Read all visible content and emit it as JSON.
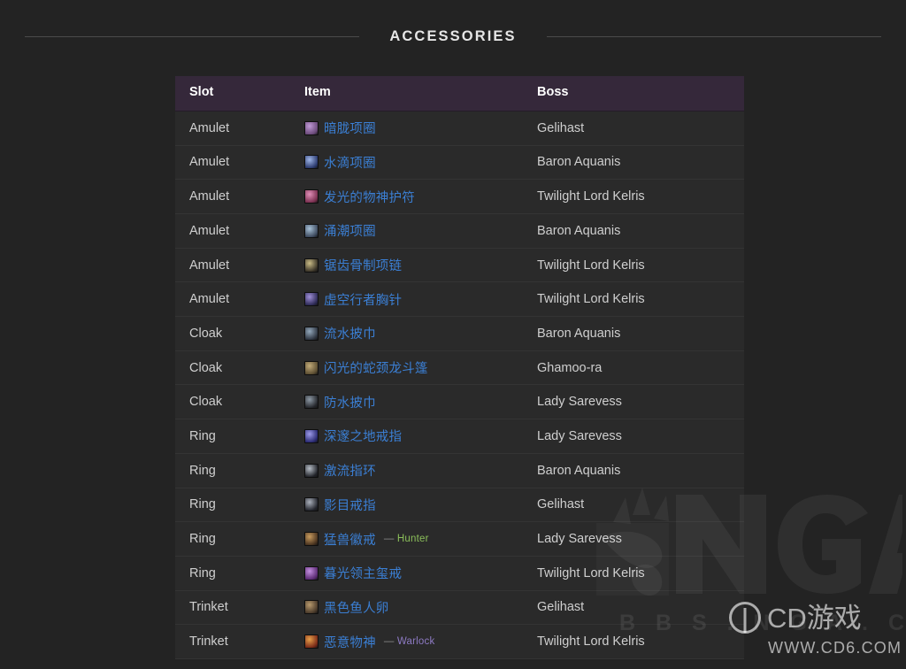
{
  "section": {
    "title": "ACCESSORIES"
  },
  "table": {
    "columns": [
      "Slot",
      "Item",
      "Boss"
    ],
    "rows": [
      {
        "slot": "Amulet",
        "item": "暗胧项圈",
        "icon": "#6b4a7a",
        "icon2": "#c09ad6",
        "class": "",
        "boss": "Gelihast"
      },
      {
        "slot": "Amulet",
        "item": "水滴项圈",
        "icon": "#2b3a6e",
        "icon2": "#9fb6e8",
        "class": "",
        "boss": "Baron Aquanis"
      },
      {
        "slot": "Amulet",
        "item": "发光的物神护符",
        "icon": "#7a3050",
        "icon2": "#e08fb8",
        "class": "",
        "boss": "Twilight Lord Kelris"
      },
      {
        "slot": "Amulet",
        "item": "涌潮项圈",
        "icon": "#3d4a5e",
        "icon2": "#a8c2d8",
        "class": "",
        "boss": "Baron Aquanis"
      },
      {
        "slot": "Amulet",
        "item": "锯齿骨制项链",
        "icon": "#3a3428",
        "icon2": "#c9bb86",
        "class": "",
        "boss": "Twilight Lord Kelris"
      },
      {
        "slot": "Amulet",
        "item": "虚空行者胸针",
        "icon": "#2d2a55",
        "icon2": "#9f8fd8",
        "class": "",
        "boss": "Twilight Lord Kelris"
      },
      {
        "slot": "Cloak",
        "item": "流水披巾",
        "icon": "#2e3540",
        "icon2": "#93a8bb",
        "class": "",
        "boss": "Baron Aquanis"
      },
      {
        "slot": "Cloak",
        "item": "闪光的蛇颈龙斗篷",
        "icon": "#5c4e32",
        "icon2": "#c2ab79",
        "class": "",
        "boss": "Ghamoo-ra"
      },
      {
        "slot": "Cloak",
        "item": "防水披巾",
        "icon": "#24262b",
        "icon2": "#8e9aa6",
        "class": "",
        "boss": "Lady Sarevess"
      },
      {
        "slot": "Ring",
        "item": "深邃之地戒指",
        "icon": "#2a2a72",
        "icon2": "#9d9bea",
        "class": "",
        "boss": "Lady Sarevess"
      },
      {
        "slot": "Ring",
        "item": "激流指环",
        "icon": "#22242a",
        "icon2": "#b7bec7",
        "class": "",
        "boss": "Baron Aquanis"
      },
      {
        "slot": "Ring",
        "item": "影目戒指",
        "icon": "#24262e",
        "icon2": "#aab0bb",
        "class": "",
        "boss": "Gelihast"
      },
      {
        "slot": "Ring",
        "item": "猛兽徽戒",
        "icon": "#4a3420",
        "icon2": "#c89b5e",
        "class": "Hunter",
        "class_color": "#8bbf5a",
        "boss": "Lady Sarevess"
      },
      {
        "slot": "Ring",
        "item": "暮光领主玺戒",
        "icon": "#5a2a72",
        "icon2": "#c48fe0",
        "class": "",
        "boss": "Twilight Lord Kelris"
      },
      {
        "slot": "Trinket",
        "item": "黑色鱼人卵",
        "icon": "#4a3a2a",
        "icon2": "#b89a6e",
        "class": "",
        "boss": "Gelihast"
      },
      {
        "slot": "Trinket",
        "item": "恶意物神",
        "icon": "#7a2a18",
        "icon2": "#e8a04a",
        "class": "Warlock",
        "class_color": "#8d7ac3",
        "boss": "Twilight Lord Kelris"
      }
    ]
  },
  "watermarks": {
    "nga_forum": "B B S . N G A . C N",
    "cd_name": "CD游戏",
    "cd_url": "WWW.CD6.COM"
  },
  "colors": {
    "page_bg": "#232323",
    "header_bg": "#35283a",
    "row_bg": "#2a2a2a",
    "item_link": "#3b7fd4",
    "hunter_green": "#8bbf5a",
    "warlock_purple": "#8d7ac3"
  }
}
